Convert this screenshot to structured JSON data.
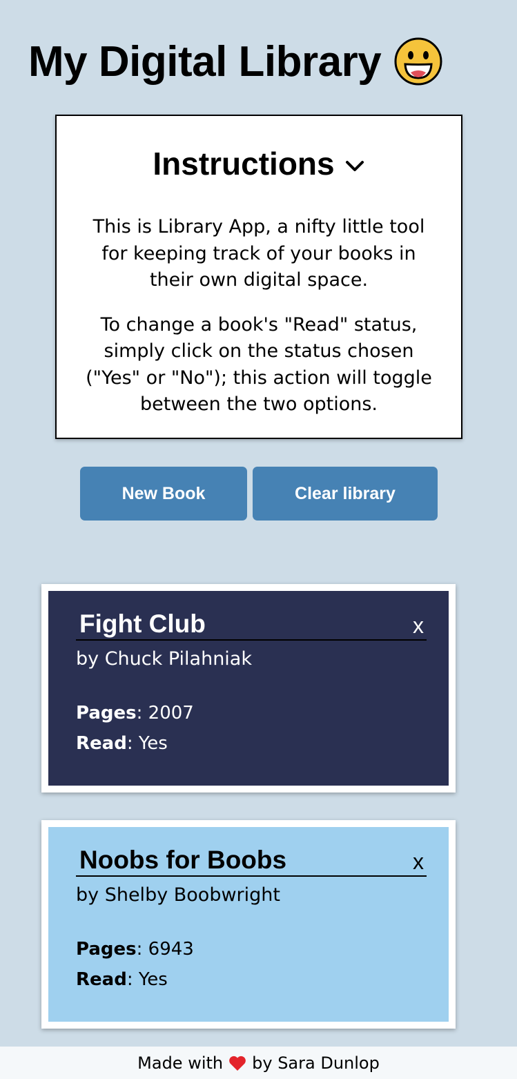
{
  "header": {
    "title": "My Digital Library",
    "emoji_icon": "grinning-face-icon"
  },
  "instructions": {
    "heading": "Instructions",
    "toggle_icon": "chevron-down-icon",
    "paragraph1": "This is Library App, a nifty little tool for keeping track of your books in their own digital space.",
    "paragraph2": "To change a book's \"Read\" status, simply click on the status chosen (\"Yes\" or \"No\"); this action will toggle between the two options."
  },
  "toolbar": {
    "new_book_label": "New Book",
    "clear_library_label": "Clear library"
  },
  "books": [
    {
      "title": "Fight Club",
      "author": "by Chuck Pilahniak",
      "pages_label": "Pages",
      "pages": "2007",
      "read_label": "Read",
      "read": "Yes",
      "remove_label": "x",
      "color": "#2a3052"
    },
    {
      "title": "Noobs for Boobs",
      "author": "by Shelby Boobwright",
      "pages_label": "Pages",
      "pages": "6943",
      "read_label": "Read",
      "read": "Yes",
      "remove_label": "x",
      "color": "#9fd0ef"
    }
  ],
  "footer": {
    "prefix": "Made with",
    "heart_icon": "heart-icon",
    "suffix": "by Sara Dunlop"
  },
  "colors": {
    "background": "#cddce7",
    "button": "#4682b4",
    "heart": "#e3242b"
  }
}
